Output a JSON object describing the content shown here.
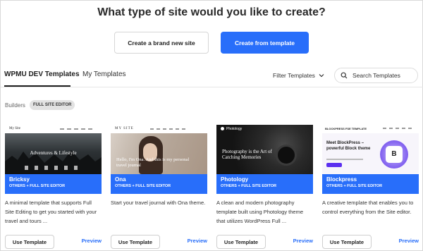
{
  "heading": "What type of site would you like to create?",
  "create_buttons": {
    "new_label": "Create a brand new site",
    "template_label": "Create from template"
  },
  "tabs": [
    {
      "label": "WPMU DEV Templates"
    },
    {
      "label": "My Templates"
    }
  ],
  "filter": {
    "label": "Filter Templates"
  },
  "search": {
    "placeholder": "Search Templates"
  },
  "builders": {
    "label": "Builders",
    "chip": "Full Site Editor"
  },
  "cards": [
    {
      "name": "Bricksy",
      "tags": "OTHERS + FULL SITE EDITOR",
      "description": "A minimal template that supports Full Site Editing to get you started with your travel and tours ...",
      "thumb": {
        "site": "My Site",
        "line1": "Adventures & Lifestyle"
      }
    },
    {
      "name": "Ona",
      "tags": "OTHERS + FULL SITE EDITOR",
      "description": "Start your travel journal with Ona theme.",
      "thumb": {
        "site": "MY SITE",
        "line1": "Hello, I'm Ona. And this is my personal travel journal"
      }
    },
    {
      "name": "Photology",
      "tags": "OTHERS + FULL SITE EDITOR",
      "description": "A clean and modern photography template built using Photology theme that utilizes WordPress Full ...",
      "thumb": {
        "site": "Photology",
        "line1": "Photography is the Art of Catching Memories"
      }
    },
    {
      "name": "Blockpress",
      "tags": "OTHERS + FULL SITE EDITOR",
      "description": "A creative template that enables you to control everything from the Site editor.",
      "thumb": {
        "site": "BLOCKPRESS FSE TEMPLATE",
        "line1": "Meet BlockPress – powerful Block theme",
        "badge": "B"
      }
    }
  ],
  "actions": {
    "use_label": "Use Template",
    "preview_label": "Preview"
  },
  "colors": {
    "accent": "#286efa",
    "text": "#1e1e1e"
  }
}
